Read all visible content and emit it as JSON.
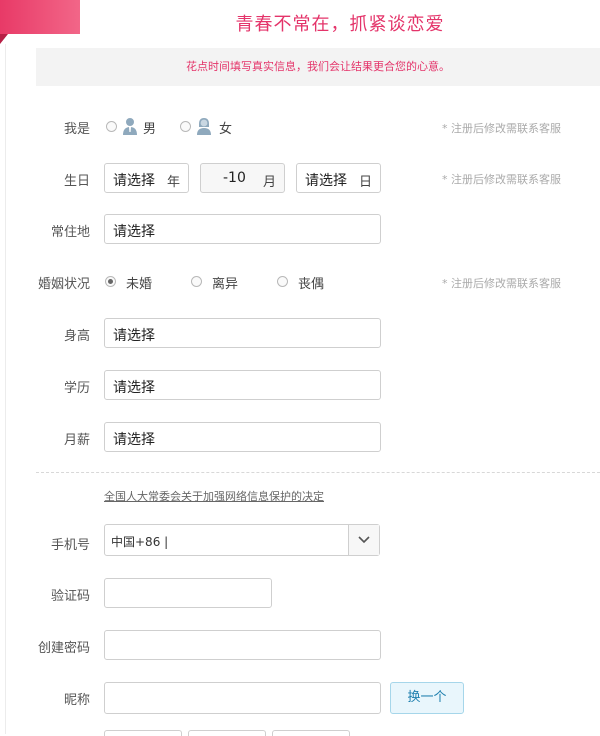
{
  "header": {
    "title": "青春不常在，抓紧谈恋爱",
    "notice": "花点时间填写真实信息，我们会让结果更合您的心意。"
  },
  "gender": {
    "label": "我是",
    "options": [
      "男",
      "女"
    ],
    "hint": "* 注册后修改需联系客服"
  },
  "birthday": {
    "label": "生日",
    "year_value": "请选择",
    "year_unit": "年",
    "month_value": "-10",
    "month_unit": "月",
    "day_value": "请选择",
    "day_unit": "日",
    "hint": "* 注册后修改需联系客服"
  },
  "residence": {
    "label": "常住地",
    "value": "请选择"
  },
  "marital": {
    "label": "婚姻状况",
    "options": [
      "未婚",
      "离异",
      "丧偶"
    ],
    "selected": "未婚",
    "hint": "* 注册后修改需联系客服"
  },
  "height": {
    "label": "身高",
    "value": "请选择"
  },
  "education": {
    "label": "学历",
    "value": "请选择"
  },
  "salary": {
    "label": "月薪",
    "value": "请选择"
  },
  "law_link": "全国人大常委会关于加强网络信息保护的决定",
  "phone": {
    "label": "手机号",
    "value": "中国+86 |"
  },
  "captcha": {
    "label": "验证码",
    "value": ""
  },
  "password": {
    "label": "创建密码",
    "value": ""
  },
  "nickname": {
    "label": "昵称",
    "value": "",
    "swap_label": "换一个"
  },
  "colors": {
    "accent": "#e4346a",
    "link": "#1e7fae"
  }
}
